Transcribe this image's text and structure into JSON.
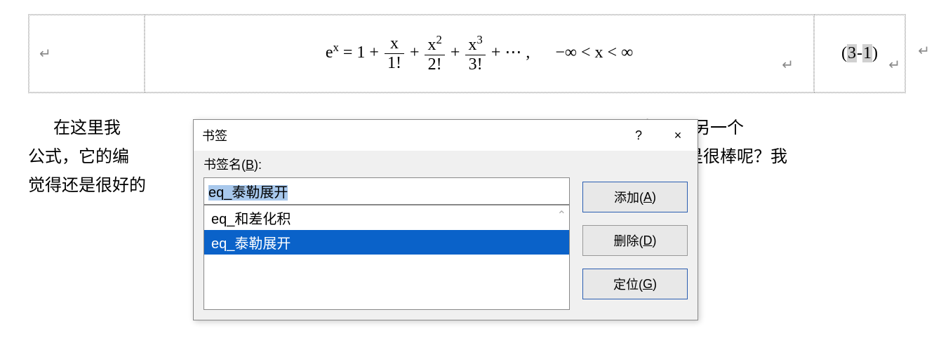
{
  "equation": {
    "formula_html": "e<span class='sup'>x</span> = 1 + <span class='frac'><span class='num'>x</span><span class='den'>1!</span></span> + <span class='frac'><span class='num'>x<span class='sup'>2</span></span><span class='den'>2!</span></span> + <span class='frac'><span class='num'>x<span class='sup'>3</span></span><span class='den'>3!</span></span> + ⋯ ,&nbsp;&nbsp;&nbsp;&nbsp;&nbsp;&nbsp;−∞ &lt; x &lt; ∞",
    "ref_prefix": "(",
    "ref_a": "3",
    "ref_sep": "-",
    "ref_b": "1",
    "ref_suffix": ")",
    "pm1": "↵",
    "pm2": "↵",
    "pm3": "↵"
  },
  "body_text": {
    "line1_pre": "在这里我",
    "line1_post": "又想引用另一个",
    "line2_pre": "公式，它的编",
    "line2_post": "不是很棒呢？我",
    "line3": "觉得还是很好的"
  },
  "page_mark": "↵",
  "dialog": {
    "title": "书签",
    "help": "?",
    "close": "×",
    "label_pre": "书签名(",
    "label_u": "B",
    "label_post": "):",
    "input_value": "eq_泰勒展开",
    "list": {
      "items": [
        {
          "label": "eq_和差化积",
          "selected": false
        },
        {
          "label": "eq_泰勒展开",
          "selected": true
        }
      ],
      "scroll_glyph": "⌃"
    },
    "buttons": {
      "add_pre": "添加(",
      "add_u": "A",
      "add_post": ")",
      "del_pre": "删除(",
      "del_u": "D",
      "del_post": ")",
      "goto_pre": "定位(",
      "goto_u": "G",
      "goto_post": ")"
    }
  }
}
